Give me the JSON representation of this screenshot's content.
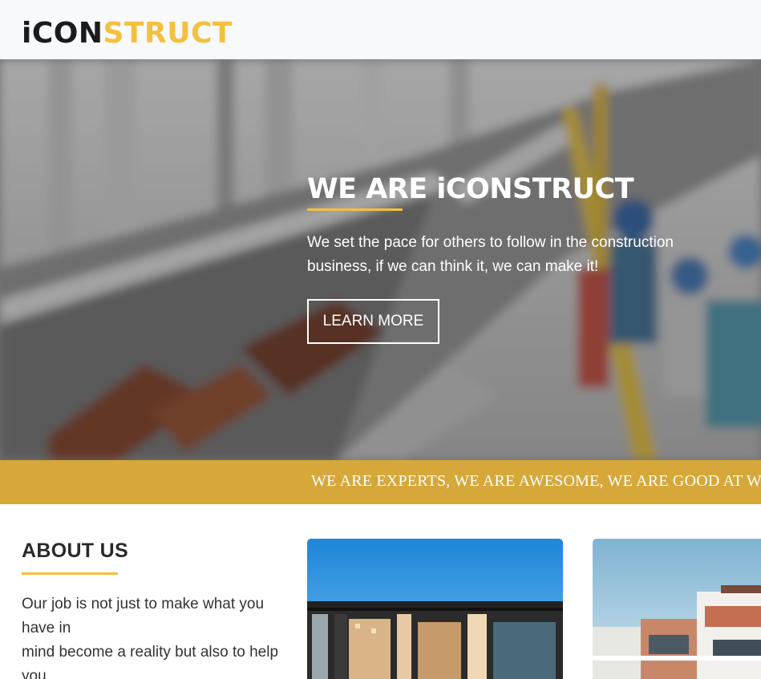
{
  "header": {
    "logo_dark": "iCON",
    "logo_accent": "STRUCT"
  },
  "hero": {
    "title": "WE ARE iCONSTRUCT",
    "text": "We set the pace for others to follow in the construction business, if we can think it, we can make it!",
    "button_label": "LEARN MORE"
  },
  "banner": {
    "text": "WE ARE EXPERTS, WE ARE AWESOME, WE ARE GOOD AT WHAT WE DO"
  },
  "about": {
    "title": "ABOUT US",
    "text_line1": "Our job is not just to make what you have in",
    "text_line2": "mind become a reality but also to help you"
  },
  "colors": {
    "accent": "#f4c03d",
    "banner": "#d6a83a"
  }
}
